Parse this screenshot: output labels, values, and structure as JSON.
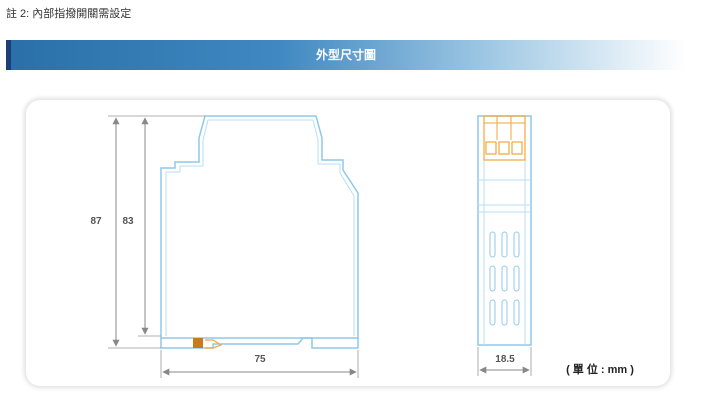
{
  "note": "註 2: 內部指撥開關需設定",
  "section_title": "外型尺寸圖",
  "dimensions": {
    "height_outer": "87",
    "height_inner": "83",
    "width_side": "75",
    "width_front": "18.5"
  },
  "unit_label": "( 單 位 : mm )",
  "colors": {
    "outline": "#8ec9ea",
    "terminal": "#f0a63b",
    "terminal_fill": "#c77a1f",
    "dimension_line": "#888888",
    "banner_start": "#2a6fa8",
    "banner_accent": "#1d3f77"
  }
}
